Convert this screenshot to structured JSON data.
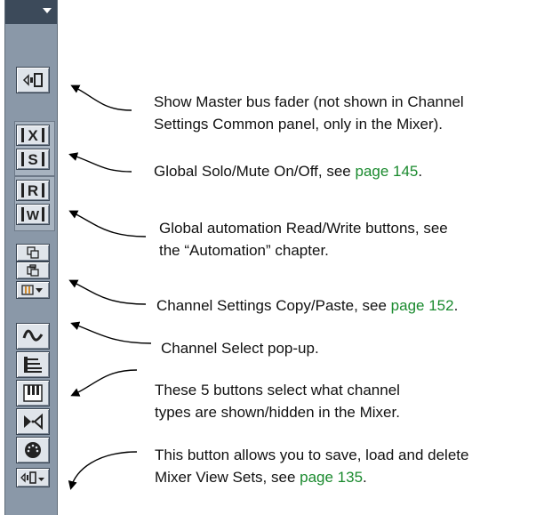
{
  "annotations": [
    {
      "line1": "Show Master bus fader (not shown in Channel",
      "line2": "Settings Common panel, only in the Mixer)."
    },
    {
      "text": "Global Solo/Mute On/Off, see ",
      "link": "page 145",
      "suffix": "."
    },
    {
      "line1": "Global automation Read/Write buttons, see",
      "line2": "the “Automation” chapter."
    },
    {
      "text": "Channel Settings Copy/Paste, see ",
      "link": "page 152",
      "suffix": "."
    },
    {
      "text": "Channel Select pop-up."
    },
    {
      "line1": "These 5 buttons select what channel",
      "line2": "types are shown/hidden in the Mixer."
    },
    {
      "line1": "This button allows you to save, load and delete",
      "line2_text": "Mixer View Sets, see ",
      "link": "page 135",
      "suffix": "."
    }
  ],
  "buttons": {
    "master_fader": "show-master-icon",
    "mute": "X",
    "solo": "S",
    "read": "R",
    "write": "W"
  },
  "colors": {
    "panel": "#8a98a8",
    "panel_header": "#3c4a5a",
    "link": "#1a8a2e"
  }
}
